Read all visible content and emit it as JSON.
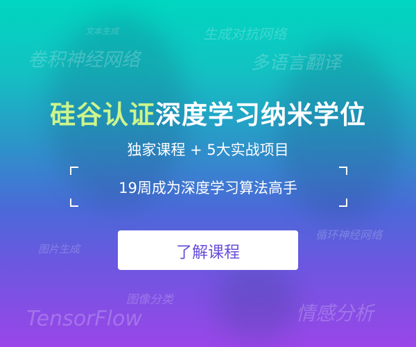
{
  "title": {
    "highlight": "硅谷认证",
    "rest": "深度学习纳米学位"
  },
  "subtitle": "独家课程 + 5大实战项目",
  "tagline": "19周成为深度学习算法高手",
  "cta_button": "了解课程",
  "keywords": {
    "text_gen": "文本生成",
    "cnn": "卷积神经网络",
    "gan": "生成对抗网络",
    "translation": "多语言翻译",
    "rnn": "循环神经网络",
    "image_gen": "图片生成",
    "image_cls": "图像分类",
    "tensorflow": "TensorFlow",
    "sentiment": "情感分析"
  },
  "colors": {
    "highlight": "#cdf58c",
    "button_text": "#6a4fd8",
    "top": "#00d6c0",
    "bottom": "#9a46e8"
  }
}
